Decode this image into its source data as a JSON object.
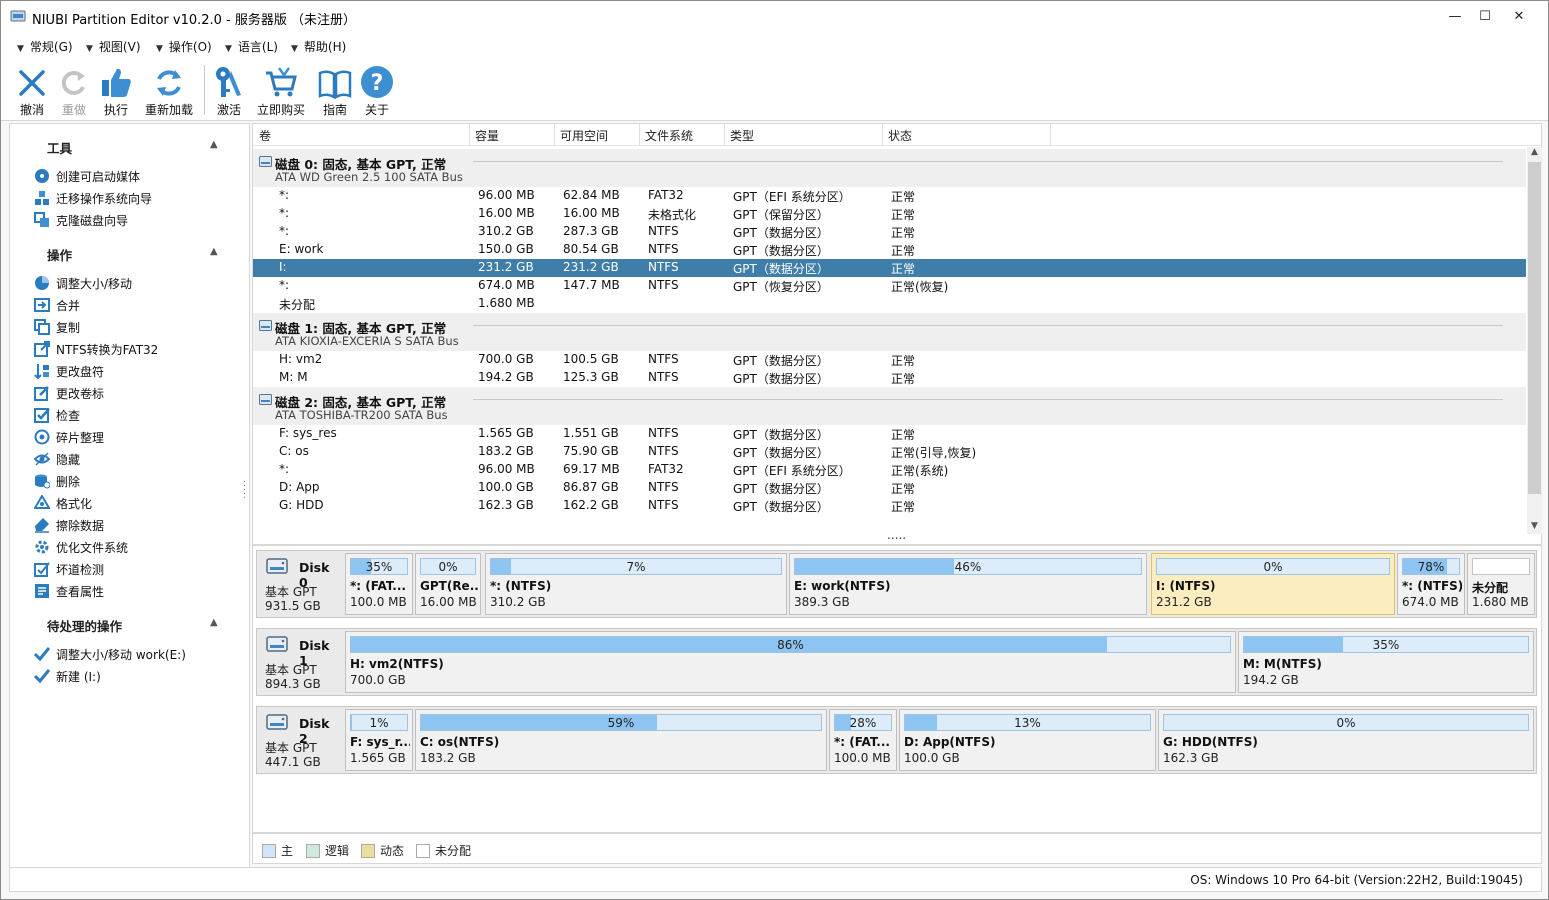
{
  "window": {
    "title": "NIUBI Partition Editor v10.2.0 - 服务器版  （未注册）",
    "minimize": "—",
    "maximize": "☐",
    "close": "✕"
  },
  "menu": [
    {
      "label": "常规(G)"
    },
    {
      "label": "视图(V)"
    },
    {
      "label": "操作(O)"
    },
    {
      "label": "语言(L)"
    },
    {
      "label": "帮助(H)"
    }
  ],
  "toolbar": {
    "undo": "撤消",
    "redo": "重做",
    "apply": "执行",
    "reload": "重新加载",
    "activate": "激活",
    "buy": "立即购买",
    "guide": "指南",
    "about": "关于"
  },
  "sidebar": {
    "tools": {
      "title": "工具",
      "items": [
        "创建可启动媒体",
        "迁移操作系统向导",
        "克隆磁盘向导"
      ]
    },
    "operations": {
      "title": "操作",
      "items": [
        "调整大小/移动",
        "合并",
        "复制",
        "NTFS转换为FAT32",
        "更改盘符",
        "更改卷标",
        "检查",
        "碎片整理",
        "隐藏",
        "删除",
        "格式化",
        "擦除数据",
        "优化文件系统",
        "坏道检测",
        "查看属性"
      ]
    },
    "pending": {
      "title": "待处理的操作",
      "items": [
        "调整大小/移动 work(E:)",
        "新建 (I:)"
      ]
    }
  },
  "list": {
    "columns": [
      "卷",
      "容量",
      "可用空间",
      "文件系统",
      "类型",
      "状态"
    ],
    "disks": [
      {
        "name": "磁盘 0: 固态, 基本 GPT, 正常",
        "bus": "ATA WD Green 2.5 100 SATA Bus",
        "volumes": [
          {
            "vol": "*:",
            "cap": "96.00 MB",
            "free": "62.84 MB",
            "fs": "FAT32",
            "type": "GPT（EFI 系统分区）",
            "status": "正常"
          },
          {
            "vol": "*:",
            "cap": "16.00 MB",
            "free": "16.00 MB",
            "fs": "未格式化",
            "type": "GPT（保留分区）",
            "status": "正常"
          },
          {
            "vol": "*:",
            "cap": "310.2 GB",
            "free": "287.3 GB",
            "fs": "NTFS",
            "type": "GPT（数据分区）",
            "status": "正常"
          },
          {
            "vol": "E: work",
            "cap": "150.0 GB",
            "free": "80.54 GB",
            "fs": "NTFS",
            "type": "GPT（数据分区）",
            "status": "正常"
          },
          {
            "vol": "I:",
            "cap": "231.2 GB",
            "free": "231.2 GB",
            "fs": "NTFS",
            "type": "GPT（数据分区）",
            "status": "正常"
          },
          {
            "vol": "*:",
            "cap": "674.0 MB",
            "free": "147.7 MB",
            "fs": "NTFS",
            "type": "GPT（恢复分区）",
            "status": "正常(恢复)"
          },
          {
            "vol": "未分配",
            "cap": "1.680 MB",
            "free": "",
            "fs": "",
            "type": "",
            "status": ""
          }
        ]
      },
      {
        "name": "磁盘 1: 固态, 基本 GPT, 正常",
        "bus": "ATA KIOXIA-EXCERIA S SATA Bus",
        "volumes": [
          {
            "vol": "H: vm2",
            "cap": "700.0 GB",
            "free": "100.5 GB",
            "fs": "NTFS",
            "type": "GPT（数据分区）",
            "status": "正常"
          },
          {
            "vol": "M: M",
            "cap": "194.2 GB",
            "free": "125.3 GB",
            "fs": "NTFS",
            "type": "GPT（数据分区）",
            "status": "正常"
          }
        ]
      },
      {
        "name": "磁盘 2: 固态, 基本 GPT, 正常",
        "bus": "ATA TOSHIBA-TR200 SATA Bus",
        "volumes": [
          {
            "vol": "F: sys_res",
            "cap": "1.565 GB",
            "free": "1.551 GB",
            "fs": "NTFS",
            "type": "GPT（数据分区）",
            "status": "正常"
          },
          {
            "vol": "C: os",
            "cap": "183.2 GB",
            "free": "75.90 GB",
            "fs": "NTFS",
            "type": "GPT（数据分区）",
            "status": "正常(引导,恢复)"
          },
          {
            "vol": "*:",
            "cap": "96.00 MB",
            "free": "69.17 MB",
            "fs": "FAT32",
            "type": "GPT（EFI 系统分区）",
            "status": "正常(系统)"
          },
          {
            "vol": "D: App",
            "cap": "100.0 GB",
            "free": "86.87 GB",
            "fs": "NTFS",
            "type": "GPT（数据分区）",
            "status": "正常"
          },
          {
            "vol": "G: HDD",
            "cap": "162.3 GB",
            "free": "162.2 GB",
            "fs": "NTFS",
            "type": "GPT（数据分区）",
            "status": "正常"
          }
        ]
      }
    ],
    "more": "....."
  },
  "diskmap": [
    {
      "name": "Disk 0",
      "type": "基本 GPT",
      "size": "931.5 GB",
      "parts": [
        {
          "pct": "35%",
          "fill": 0.35,
          "name": "*: (FAT...",
          "size": "100.0 MB"
        },
        {
          "pct": "0%",
          "fill": 0.0,
          "name": "GPT(Re...",
          "size": "16.00 MB"
        },
        {
          "pct": "7%",
          "fill": 0.07,
          "name": "*: (NTFS)",
          "size": "310.2 GB"
        },
        {
          "pct": "46%",
          "fill": 0.46,
          "name": "E: work(NTFS)",
          "size": "389.3 GB"
        },
        {
          "pct": "0%",
          "fill": 0.0,
          "name": "I: (NTFS)",
          "size": "231.2 GB"
        },
        {
          "pct": "78%",
          "fill": 0.78,
          "name": "*: (NTFS)",
          "size": "674.0 MB"
        },
        {
          "pct": "",
          "fill": 0.0,
          "name": "未分配",
          "size": "1.680 MB"
        }
      ]
    },
    {
      "name": "Disk 1",
      "type": "基本 GPT",
      "size": "894.3 GB",
      "parts": [
        {
          "pct": "86%",
          "fill": 0.86,
          "name": "H: vm2(NTFS)",
          "size": "700.0 GB"
        },
        {
          "pct": "35%",
          "fill": 0.35,
          "name": "M: M(NTFS)",
          "size": "194.2 GB"
        }
      ]
    },
    {
      "name": "Disk 2",
      "type": "基本 GPT",
      "size": "447.1 GB",
      "parts": [
        {
          "pct": "1%",
          "fill": 0.01,
          "name": "F: sys_r...",
          "size": "1.565 GB"
        },
        {
          "pct": "59%",
          "fill": 0.59,
          "name": "C: os(NTFS)",
          "size": "183.2 GB"
        },
        {
          "pct": "28%",
          "fill": 0.28,
          "name": "*: (FAT...",
          "size": "100.0 MB"
        },
        {
          "pct": "13%",
          "fill": 0.13,
          "name": "D: App(NTFS)",
          "size": "100.0 GB"
        },
        {
          "pct": "0%",
          "fill": 0.0,
          "name": "G: HDD(NTFS)",
          "size": "162.3 GB"
        }
      ]
    }
  ],
  "legend": [
    "主",
    "逻辑",
    "动态",
    "未分配"
  ],
  "status": "OS: Windows 10 Pro 64-bit (Version:22H2, Build:19045)",
  "colors": {
    "selection": "#3f7ea8",
    "bar_fill": "#8ec4f1",
    "bar_bg": "#dcecfa",
    "selected_partition": "#fbedbf",
    "accent_icon": "#2b7bc0"
  }
}
